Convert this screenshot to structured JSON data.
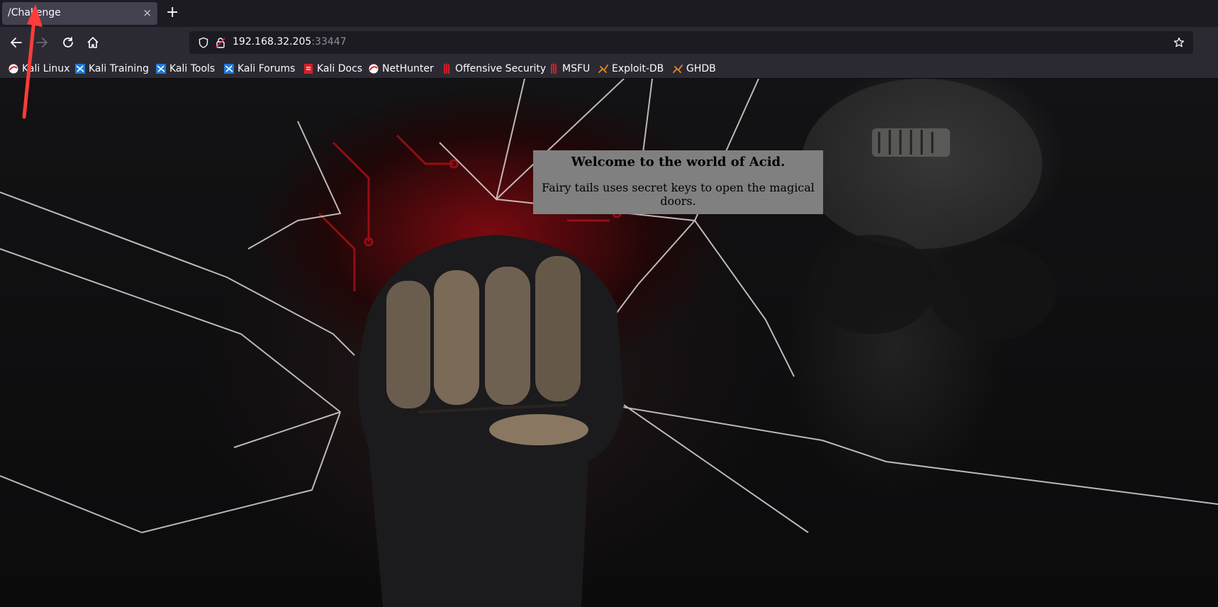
{
  "browser": {
    "tab": {
      "title": "/Challenge",
      "close_glyph": "×"
    },
    "new_tab_glyph": "+",
    "url": {
      "host": "192.168.32.205",
      "port": ":33447"
    },
    "nav_icons": [
      "back-arrow-icon",
      "forward-arrow-icon",
      "reload-icon",
      "home-icon"
    ],
    "bookmarks": [
      {
        "label": "Kali Linux",
        "icon": "kali-icon",
        "color": "#e11d2b"
      },
      {
        "label": "Kali Training",
        "icon": "kali-training-icon",
        "color": "#1e7ad6"
      },
      {
        "label": "Kali Tools",
        "icon": "kali-tools-icon",
        "color": "#1e7ad6"
      },
      {
        "label": "Kali Forums",
        "icon": "kali-forums-icon",
        "color": "#1e7ad6"
      },
      {
        "label": "Kali Docs",
        "icon": "kali-docs-icon",
        "color": "#d3202a"
      },
      {
        "label": "NetHunter",
        "icon": "nethunter-icon",
        "color": "#e11d2b"
      },
      {
        "label": "Offensive Security",
        "icon": "offsec-icon",
        "color": "#d3202a"
      },
      {
        "label": "MSFU",
        "icon": "msfu-icon",
        "color": "#d3202a"
      },
      {
        "label": "Exploit-DB",
        "icon": "exploitdb-icon",
        "color": "#e38a1e"
      },
      {
        "label": "GHDB",
        "icon": "ghdb-icon",
        "color": "#e38a1e"
      }
    ]
  },
  "page": {
    "welcome_title": "Welcome to the world of Acid.",
    "welcome_text": "Fairy tails uses secret keys to open the magical doors."
  },
  "annotation": {
    "color": "#ff3b3b"
  }
}
